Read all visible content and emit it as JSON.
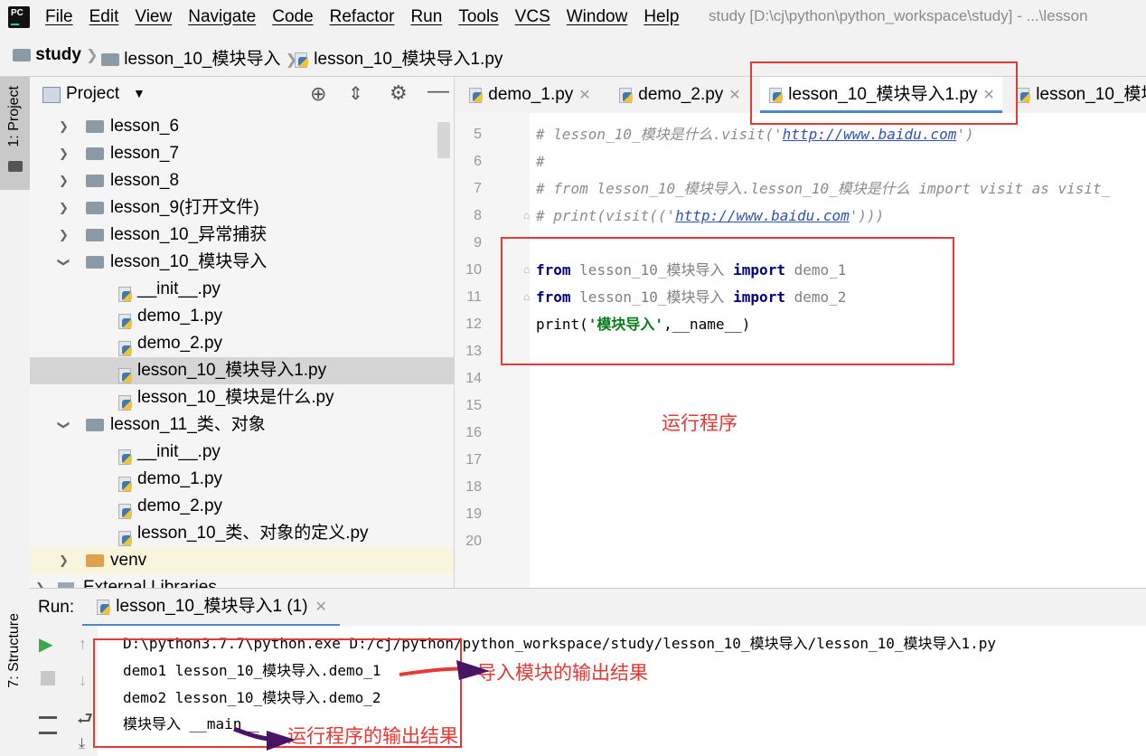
{
  "menubar": {
    "items": [
      "File",
      "Edit",
      "View",
      "Navigate",
      "Code",
      "Refactor",
      "Run",
      "Tools",
      "VCS",
      "Window",
      "Help"
    ],
    "window_title": "study [D:\\cj\\python\\python_workspace\\study] - ...\\lesson",
    "logo_text": "PC"
  },
  "breadcrumb": {
    "items": [
      "study",
      "lesson_10_模块导入",
      "lesson_10_模块导入1.py"
    ]
  },
  "left_strip": {
    "project_label": "1: Project",
    "structure_label": "7: Structure"
  },
  "project": {
    "title": "Project",
    "tree": [
      {
        "label": "lesson_6"
      },
      {
        "label": "lesson_7"
      },
      {
        "label": "lesson_8"
      },
      {
        "label": "lesson_9(打开文件)"
      },
      {
        "label": "lesson_10_异常捕获"
      },
      {
        "label": "lesson_10_模块导入"
      },
      {
        "label": "__init__.py"
      },
      {
        "label": "demo_1.py"
      },
      {
        "label": "demo_2.py"
      },
      {
        "label": "lesson_10_模块导入1.py"
      },
      {
        "label": "lesson_10_模块是什么.py"
      },
      {
        "label": "lesson_11_类、对象"
      },
      {
        "label": "__init__.py"
      },
      {
        "label": "demo_1.py"
      },
      {
        "label": "demo_2.py"
      },
      {
        "label": "lesson_10_类、对象的定义.py"
      },
      {
        "label": "venv"
      },
      {
        "label": "External Libraries"
      }
    ]
  },
  "editor": {
    "tabs": [
      "demo_1.py",
      "demo_2.py",
      "lesson_10_模块导入1.py",
      "lesson_10_模块"
    ],
    "line_numbers": [
      "5",
      "6",
      "7",
      "8",
      "9",
      "10",
      "11",
      "12",
      "13",
      "14",
      "15",
      "16",
      "17",
      "18",
      "19",
      "20"
    ],
    "lines": {
      "l5_pre": "# lesson_10_模块是什么.visit('",
      "l5_url": "http://www.baidu.com",
      "l5_post": "')",
      "l6": "#",
      "l7": "# from lesson_10_模块导入.lesson_10_模块是什么 import visit as visit_",
      "l8_pre": "# print(visit(('",
      "l8_url": "http://www.baidu.com",
      "l8_post": "')))",
      "l10_from": "from",
      "l10_mod": "lesson_10_模块导入",
      "l10_import": "import",
      "l10_name": "demo_1",
      "l11_from": "from",
      "l11_mod": "lesson_10_模块导入",
      "l11_import": "import",
      "l11_name": "demo_2",
      "l12_pre": "print(",
      "l12_str": "'模块导入'",
      "l12_post": ",__name__)"
    }
  },
  "run": {
    "label": "Run:",
    "tab": "lesson_10_模块导入1 (1)",
    "output": [
      "D:\\python3.7.7\\python.exe D:/cj/python/python_workspace/study/lesson_10_模块导入/lesson_10_模块导入1.py",
      "demo1 lesson_10_模块导入.demo_1",
      "demo2 lesson_10_模块导入.demo_2",
      "模块导入 __main__"
    ]
  },
  "annotations": {
    "run_program": "运行程序",
    "import_output": "导入模块的输出结果",
    "run_output": "运行程序的输出结果",
    "color": "#e53935"
  }
}
